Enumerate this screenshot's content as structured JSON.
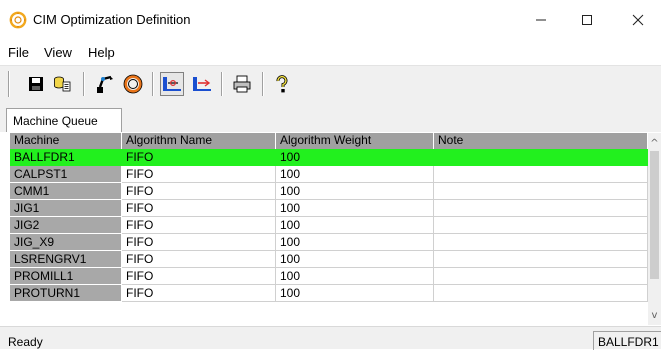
{
  "window": {
    "title": "CIM Optimization Definition",
    "controls": {
      "minimize": "—",
      "maximize": "☐",
      "close": "✕"
    }
  },
  "menu": {
    "items": [
      {
        "label": "File"
      },
      {
        "label": "View"
      },
      {
        "label": "Help"
      }
    ]
  },
  "toolbar": {
    "buttons": [
      {
        "icon": "save-icon"
      },
      {
        "icon": "database-icon"
      },
      {
        "icon": "machine-icon"
      },
      {
        "icon": "ring-icon"
      },
      {
        "icon": "link-icon"
      },
      {
        "icon": "unlink-icon"
      },
      {
        "icon": "print-icon"
      },
      {
        "icon": "help-icon"
      }
    ]
  },
  "tabs": [
    {
      "label": "Machine Queue",
      "active": true
    }
  ],
  "grid": {
    "columns": [
      "Machine",
      "Algorithm Name",
      "Algorithm Weight",
      "Note"
    ],
    "rows": [
      {
        "machine": "BALLFDR1",
        "algorithm": "FIFO",
        "weight": "100",
        "note": "",
        "selected": true
      },
      {
        "machine": "CALPST1",
        "algorithm": "FIFO",
        "weight": "100",
        "note": ""
      },
      {
        "machine": "CMM1",
        "algorithm": "FIFO",
        "weight": "100",
        "note": ""
      },
      {
        "machine": "JIG1",
        "algorithm": "FIFO",
        "weight": "100",
        "note": ""
      },
      {
        "machine": "JIG2",
        "algorithm": "FIFO",
        "weight": "100",
        "note": ""
      },
      {
        "machine": "JIG_X9",
        "algorithm": "FIFO",
        "weight": "100",
        "note": ""
      },
      {
        "machine": "LSRENGRV1",
        "algorithm": "FIFO",
        "weight": "100",
        "note": ""
      },
      {
        "machine": "PROMILL1",
        "algorithm": "FIFO",
        "weight": "100",
        "note": ""
      },
      {
        "machine": "PROTURN1",
        "algorithm": "FIFO",
        "weight": "100",
        "note": ""
      }
    ],
    "selected_color": "#22f01e",
    "header_color": "#a0a0a0"
  },
  "scrollbar": {
    "up": "^",
    "down": "v"
  },
  "status": {
    "text": "Ready",
    "pane": "BALLFDR1"
  }
}
